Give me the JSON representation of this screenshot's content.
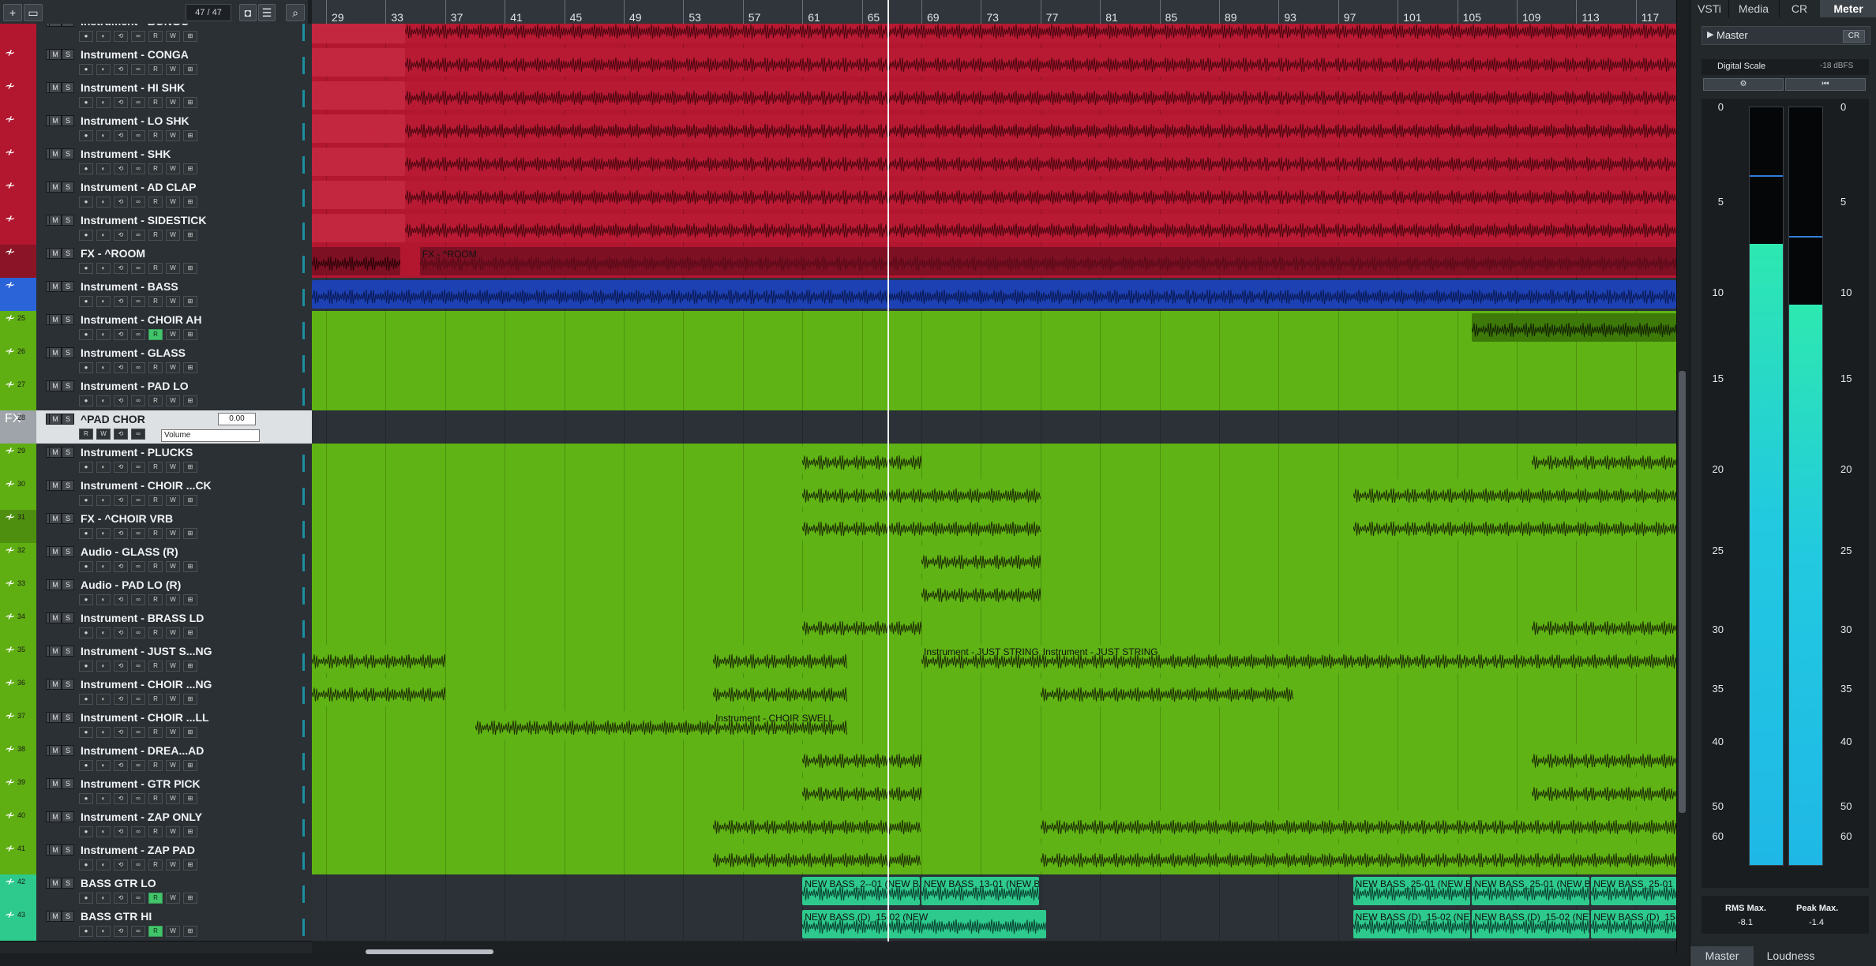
{
  "toolbar": {
    "counter": "47 / 47",
    "add_icon": "plus-icon",
    "folder_icon": "folder-icon",
    "search_icon": "search-icon"
  },
  "ruler": {
    "bars": [
      "29",
      "33",
      "37",
      "41",
      "45",
      "49",
      "53",
      "57",
      "61",
      "65",
      "69",
      "73",
      "77",
      "81",
      "85",
      "89",
      "93",
      "97",
      "101",
      "105",
      "109",
      "113",
      "117"
    ]
  },
  "tracks": [
    {
      "num": "",
      "name": "Instrument - BONGO",
      "color": "#b3162f",
      "rec": false
    },
    {
      "num": "",
      "name": "Instrument - CONGA",
      "color": "#b3162f",
      "rec": false
    },
    {
      "num": "",
      "name": "Instrument - HI SHK",
      "color": "#b3162f",
      "rec": false
    },
    {
      "num": "",
      "name": "Instrument - LO SHK",
      "color": "#b3162f",
      "rec": false
    },
    {
      "num": "",
      "name": "Instrument - SHK",
      "color": "#b3162f",
      "rec": false
    },
    {
      "num": "",
      "name": "Instrument - AD CLAP",
      "color": "#b3162f",
      "rec": false
    },
    {
      "num": "",
      "name": "Instrument - SIDESTICK",
      "color": "#b3162f",
      "rec": false
    },
    {
      "num": "",
      "name": "FX - ^ROOM",
      "color": "#8c1427",
      "rec": false
    },
    {
      "num": "",
      "name": "Instrument - BASS",
      "color": "#2b63d9",
      "rec": false
    },
    {
      "num": "25",
      "name": "Instrument - CHOIR AH",
      "color": "#5fae12",
      "rec": true
    },
    {
      "num": "26",
      "name": "Instrument - GLASS",
      "color": "#5fae12",
      "rec": false
    },
    {
      "num": "27",
      "name": "Instrument - PAD LO",
      "color": "#5fae12",
      "rec": false
    },
    {
      "num": "28",
      "name": "^PAD CHOR",
      "color": "#9ea4a9",
      "rec": false,
      "fx": true
    },
    {
      "num": "29",
      "name": "Instrument - PLUCKS",
      "color": "#5fae12",
      "rec": false
    },
    {
      "num": "30",
      "name": "Instrument - CHOIR ...CK",
      "color": "#5fae12",
      "rec": false
    },
    {
      "num": "31",
      "name": "FX - ^CHOIR VRB",
      "color": "#4f8f10",
      "rec": false
    },
    {
      "num": "32",
      "name": "Audio - GLASS (R)",
      "color": "#5fae12",
      "rec": false
    },
    {
      "num": "33",
      "name": "Audio - PAD LO (R)",
      "color": "#5fae12",
      "rec": false
    },
    {
      "num": "34",
      "name": "Instrument - BRASS LD",
      "color": "#5fae12",
      "rec": false
    },
    {
      "num": "35",
      "name": "Instrument - JUST S...NG",
      "color": "#5fae12",
      "rec": false
    },
    {
      "num": "36",
      "name": "Instrument - CHOIR ...NG",
      "color": "#5fae12",
      "rec": false
    },
    {
      "num": "37",
      "name": "Instrument - CHOIR ...LL",
      "color": "#5fae12",
      "rec": false
    },
    {
      "num": "38",
      "name": "Instrument - DREA...AD",
      "color": "#5fae12",
      "rec": false
    },
    {
      "num": "39",
      "name": "Instrument - GTR PICK",
      "color": "#5fae12",
      "rec": false
    },
    {
      "num": "40",
      "name": "Instrument - ZAP ONLY",
      "color": "#5fae12",
      "rec": false
    },
    {
      "num": "41",
      "name": "Instrument - ZAP PAD",
      "color": "#5fae12",
      "rec": false
    },
    {
      "num": "42",
      "name": "BASS GTR LO",
      "color": "#2ec98c",
      "rec": true
    },
    {
      "num": "43",
      "name": "BASS GTR HI",
      "color": "#2ec98c",
      "rec": true
    }
  ],
  "fx_track": {
    "label": "FX",
    "value": "0.00",
    "automation": "Volume"
  },
  "event_labels": {
    "room": "FX - ^ROOM",
    "just_string_1": "Instrument - JUST STRING",
    "just_string_2": "Instrument - JUST STRING",
    "choir_swell": "Instrument - CHOIR SWELL",
    "bass_lo": [
      "NEW BASS_2--01 (NEW BAS",
      "NEW BASS_13-01 (NEW BA",
      "NEW BASS_25-01 (NEW BA",
      "NEW BASS_25-01 (NEW BA",
      "NEW BASS_25-01 (NEW"
    ],
    "bass_hi": [
      "NEW BASS (D)_15-02 (NEW",
      "NEW BASS (D)_15-02 (NEW",
      "NEW BASS (D)_15-02 (NEW",
      "NEW BASS (D)_15-02 (NEW"
    ]
  },
  "right_panel": {
    "tabs": [
      "VSTi",
      "Media",
      "CR",
      "Meter"
    ],
    "active_tab": "Meter",
    "channel": "Master",
    "cr_button": "CR",
    "scale_label": "Digital Scale",
    "scale_value": "-18 dBFS",
    "scale_ticks": [
      "0",
      "5",
      "10",
      "15",
      "20",
      "25",
      "30",
      "35",
      "40",
      "50",
      "60"
    ],
    "level_left": 0.82,
    "level_right": 0.74,
    "rms_label": "RMS Max.",
    "rms_value": "-8.1",
    "peak_label": "Peak Max.",
    "peak_value": "-1.4",
    "bottom_tabs": [
      "Master",
      "Loudness"
    ]
  },
  "colors": {
    "red": "#b3162f",
    "red_dark": "#7e1023",
    "blue": "#1d41b3",
    "green": "#5fb314",
    "green_evt": "#3e7a0a",
    "teal": "#2ec98c",
    "waveform": "#1f2d06"
  }
}
